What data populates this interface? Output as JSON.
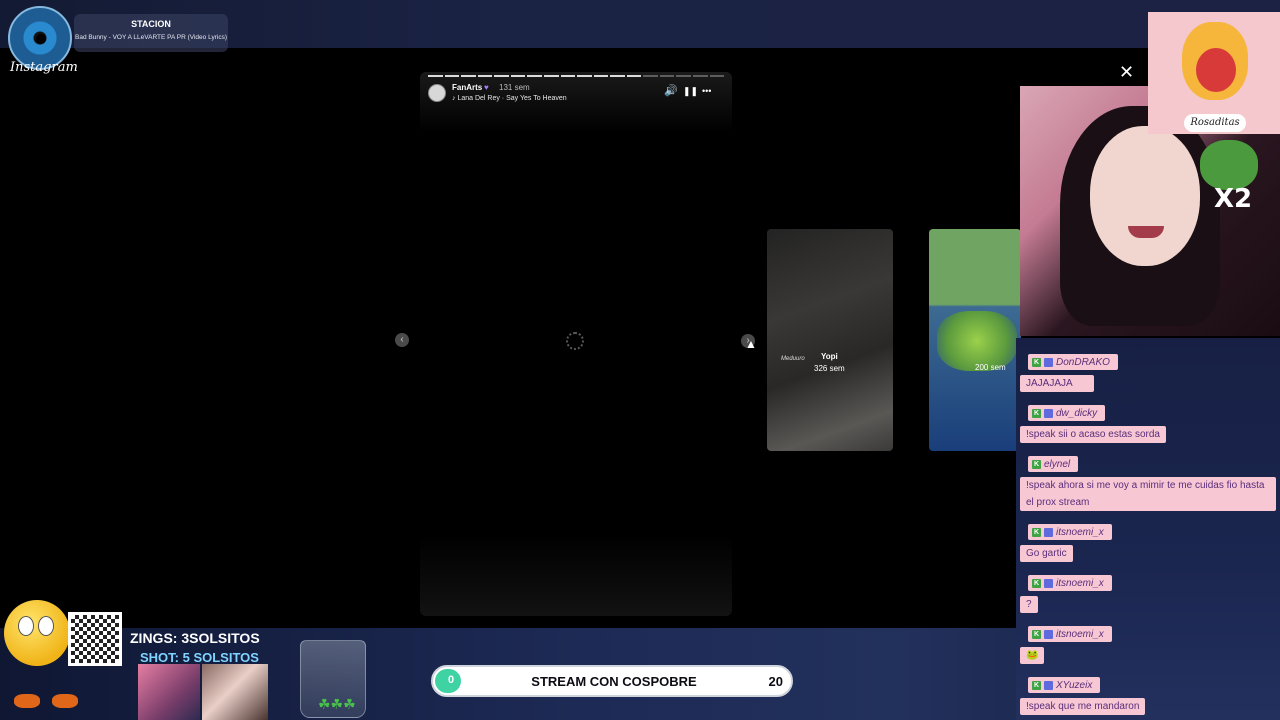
{
  "now_playing": {
    "title": "STACION",
    "track": "Bad Bunny - VOY A LLeVARTE PA PR (Video Lyrics)",
    "brand": "Instagram"
  },
  "story": {
    "username": "FanArts",
    "verified_icon": "♥",
    "time": "131 sem",
    "music": "Lana Del Rey · Say Yes To Heaven",
    "progress_segments": 18,
    "progress_done": 13,
    "controls": {
      "volume_icon": "🔊",
      "pause_icon": "❚❚",
      "more_icon": "•••"
    }
  },
  "previews": [
    {
      "username": "Yopi",
      "time": "326 sem",
      "tag": "Meduuro"
    },
    {
      "username": "",
      "time": "200 sem",
      "tag": ""
    }
  ],
  "close_icon": "✕",
  "cam": {
    "emote_label": "Rosaditas",
    "pepe_text": "X2"
  },
  "chat": {
    "messages": [
      {
        "user": "DonDRAKO",
        "text": "JAJAJAJA"
      },
      {
        "user": "dw_dicky",
        "text": "!speak sii o acaso estas sorda"
      },
      {
        "user": "elynel",
        "text": "!speak ahora si me voy a mimir te me cuidas fio hasta el prox stream"
      },
      {
        "user": "itsnoemi_x",
        "text": "Go gartic"
      },
      {
        "user": "itsnoemi_x",
        "text": "?"
      },
      {
        "user": "itsnoemi_x",
        "text": "🐸"
      },
      {
        "user": "XYuzeix",
        "text": "!speak que me mandaron"
      }
    ]
  },
  "stream": {
    "zings": "ZINGS: 3SOLSITOS",
    "shots": "SHOT: 5 SOLSITOS",
    "clovers": "☘☘☘"
  },
  "goal": {
    "title": "STREAM CON COSPOBRE",
    "current": "0",
    "target": "20",
    "progress_fraction": 0
  },
  "colors": {
    "chat_bg": "#f7c8d4",
    "goal_fill": "#3fd3a3",
    "story_bg": "#000000"
  }
}
